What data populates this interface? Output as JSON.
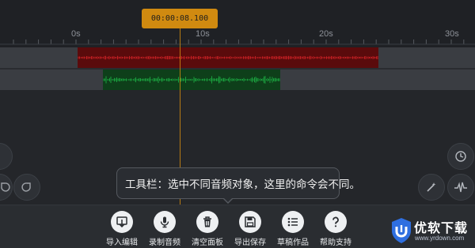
{
  "playhead": {
    "time": "00:00:08.100"
  },
  "ruler": {
    "labels": [
      "0s",
      "10s",
      "20s",
      "30s"
    ]
  },
  "tooltip": {
    "text": "工具栏：选中不同音频对象，这里的命令会不同。"
  },
  "toolbar": {
    "items": [
      {
        "label": "导入编辑",
        "icon": "import-edit-icon"
      },
      {
        "label": "录制音频",
        "icon": "microphone-icon"
      },
      {
        "label": "清空面板",
        "icon": "trash-icon"
      },
      {
        "label": "导出保存",
        "icon": "save-icon"
      },
      {
        "label": "草稿作品",
        "icon": "list-icon"
      },
      {
        "label": "帮助支持",
        "icon": "help-icon"
      }
    ]
  },
  "side_buttons": {
    "left": [
      "undo-icon",
      "redo-icon"
    ],
    "right": [
      "clock-icon",
      "magic-wand-icon",
      "waveform-icon"
    ]
  },
  "watermark": {
    "text": "优软下载",
    "url": "www.yrdown.com"
  },
  "colors": {
    "accent": "#d08a10",
    "red_track": "#e0262a",
    "green_track": "#1fbf4a",
    "background": "#1d1f23"
  }
}
